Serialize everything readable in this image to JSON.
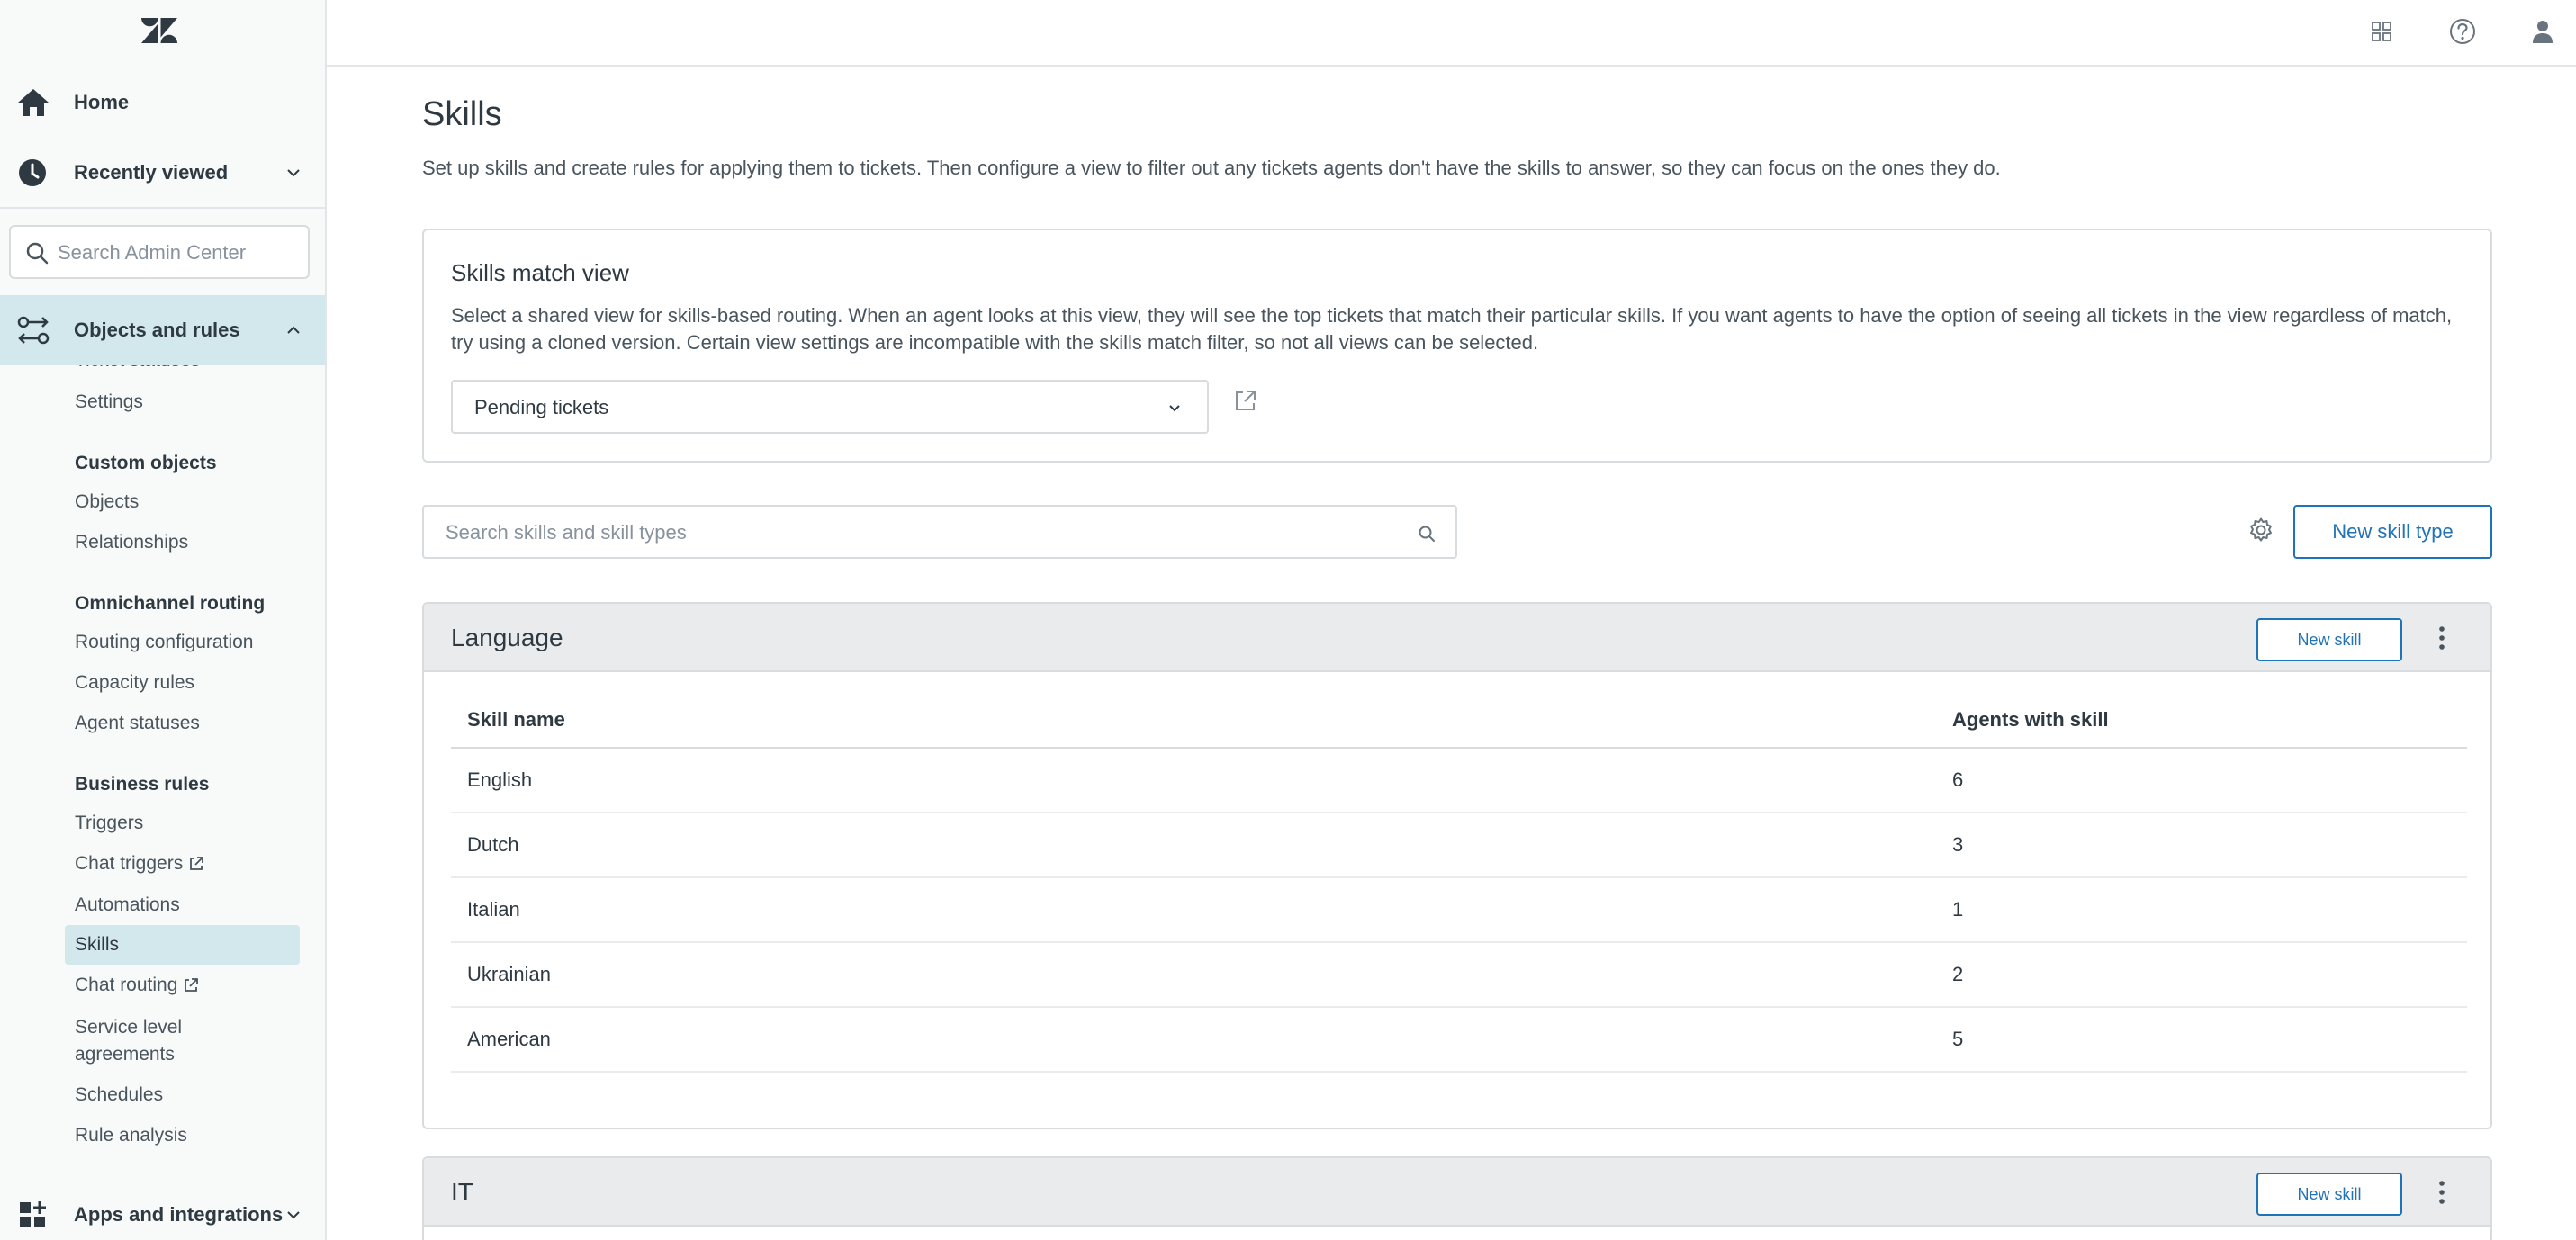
{
  "sidebar": {
    "home_label": "Home",
    "recent_label": "Recently viewed",
    "search_placeholder": "Search Admin Center",
    "objects_label": "Objects and rules",
    "partial_item": "Ticket statuses",
    "settings": "Settings",
    "custom_objects": {
      "heading": "Custom objects",
      "items": [
        "Objects",
        "Relationships"
      ]
    },
    "omnichannel": {
      "heading": "Omnichannel routing",
      "items": [
        "Routing configuration",
        "Capacity rules",
        "Agent statuses"
      ]
    },
    "business_rules": {
      "heading": "Business rules",
      "items": [
        "Triggers",
        "Chat triggers",
        "Automations",
        "Skills",
        "Chat routing",
        "Service level",
        "agreements",
        "Schedules",
        "Rule analysis"
      ]
    },
    "apps_label": "Apps and integrations"
  },
  "main": {
    "title": "Skills",
    "description": "Set up skills and create rules for applying them to tickets. Then configure a view to filter out any tickets agents don't have the skills to answer, so they can focus on the ones they do.",
    "match_view": {
      "title": "Skills match view",
      "description": "Select a shared view for skills-based routing. When an agent looks at this view, they will see the top tickets that match their particular skills. If you want agents to have the option of seeing all tickets in the view regardless of match, try using a cloned version. Certain view settings are incompatible with the skills match filter, so not all views can be selected.",
      "selected_view": "Pending tickets"
    },
    "search_placeholder": "Search skills and skill types",
    "new_skill_type_label": "New skill type",
    "skill_groups": [
      {
        "title": "Language",
        "new_skill_label": "New skill",
        "columns": [
          "Skill name",
          "Agents with skill"
        ],
        "rows": [
          [
            "English",
            "6"
          ],
          [
            "Dutch",
            "3"
          ],
          [
            "Italian",
            "1"
          ],
          [
            "Ukrainian",
            "2"
          ],
          [
            "American",
            "5"
          ]
        ]
      },
      {
        "title": "IT",
        "new_skill_label": "New skill"
      }
    ]
  },
  "colors": {
    "accent": "#1f73b7",
    "nav_active": "#d3e8ec",
    "group_header": "#e9ebed",
    "border": "#d8dcde"
  },
  "icons": [
    "zendesk-logo",
    "home-icon",
    "clock-icon",
    "chevron-down-icon",
    "chevron-up-icon",
    "search-icon",
    "objects-rules-icon",
    "external-link-icon",
    "apps-icon",
    "grid-icon",
    "help-icon",
    "user-icon",
    "gear-icon",
    "kebab-icon"
  ]
}
